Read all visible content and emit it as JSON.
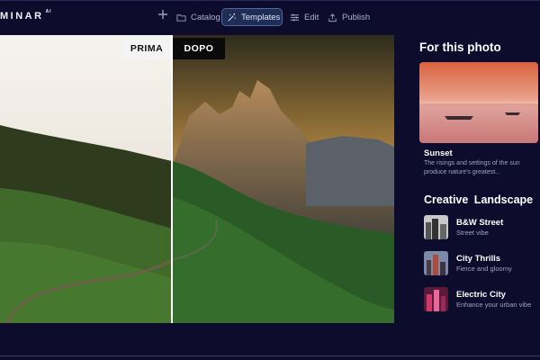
{
  "app": {
    "logo": "MINAR",
    "logo_suffix": "AI"
  },
  "toolbar": {
    "add_icon": "plus-icon",
    "nav": [
      {
        "label": "Catalog",
        "icon": "folder-icon",
        "active": false
      },
      {
        "label": "Templates",
        "icon": "magic-wand-icon",
        "active": true
      },
      {
        "label": "Edit",
        "icon": "sliders-icon",
        "active": false
      },
      {
        "label": "Publish",
        "icon": "upload-icon",
        "active": false
      }
    ]
  },
  "editor": {
    "before_label": "PRIMA",
    "after_label": "DOPO"
  },
  "panel": {
    "title": "For this photo",
    "featured": {
      "name": "Sunset",
      "description": "The risings and settings of the sun produce nature's greatest..."
    },
    "section_title": "Creative Landscape",
    "templates": [
      {
        "name": "B&W Street",
        "subtitle": "Street vibe"
      },
      {
        "name": "City Thrills",
        "subtitle": "Fierce and gloomy"
      },
      {
        "name": "Electric City",
        "subtitle": "Enhance your urban vibe"
      }
    ]
  },
  "colors": {
    "background": "#0e0c2c",
    "accent": "#4a6aa6",
    "active_tab": "#1f2d55"
  }
}
